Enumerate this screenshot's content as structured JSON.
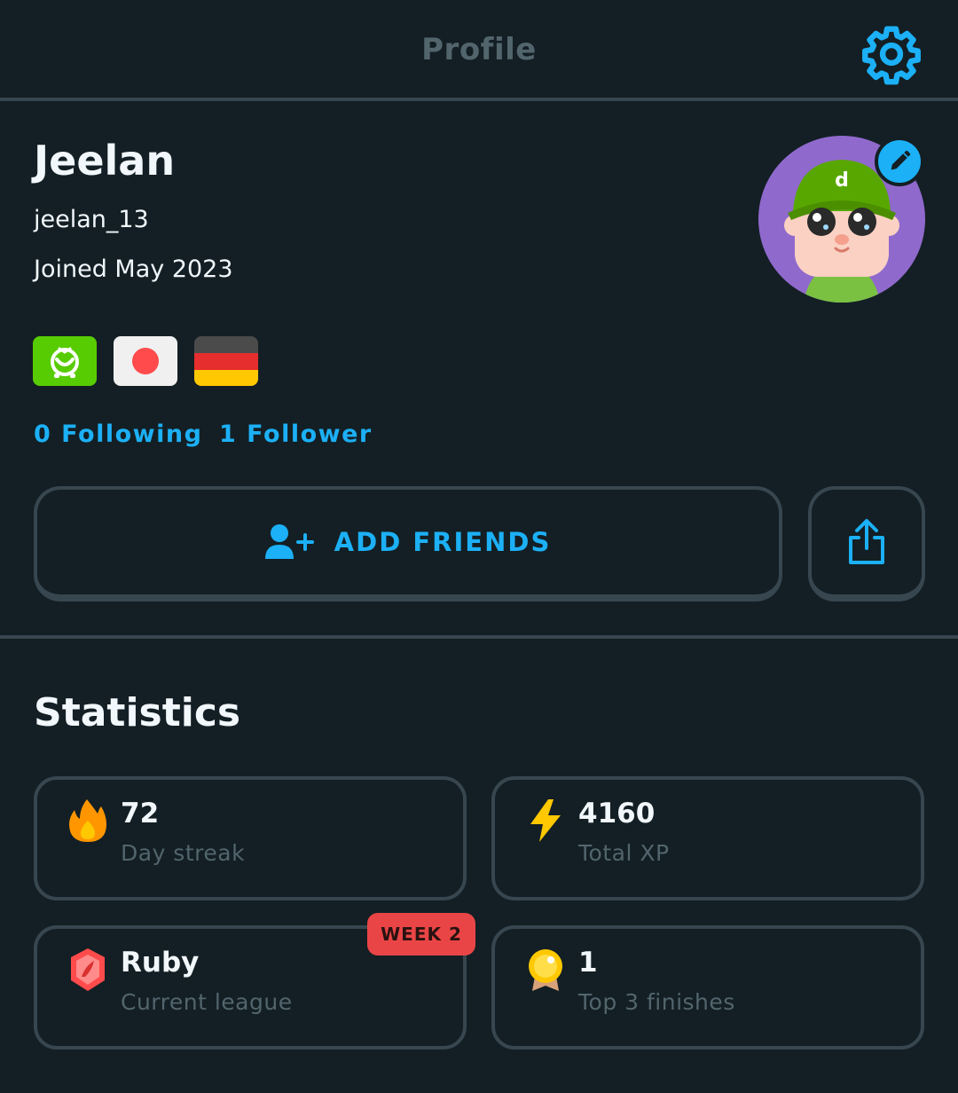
{
  "header": {
    "title": "Profile"
  },
  "profile": {
    "name": "Jeelan",
    "username": "jeelan_13",
    "joined": "Joined May 2023",
    "courses": [
      "duolingo-math-flag",
      "japan-flag",
      "germany-flag"
    ],
    "following": "0 Following",
    "followers": "1 Follower"
  },
  "actions": {
    "add_friends": "ADD FRIENDS",
    "share_icon": "share-icon"
  },
  "statistics": {
    "title": "Statistics",
    "cards": [
      {
        "value": "72",
        "label": "Day streak",
        "icon": "fire-icon"
      },
      {
        "value": "4160",
        "label": "Total XP",
        "icon": "lightning-icon"
      },
      {
        "value": "Ruby",
        "label": "Current league",
        "icon": "ruby-league-icon",
        "badge": "WEEK 2"
      },
      {
        "value": "1",
        "label": "Top 3 finishes",
        "icon": "medal-icon"
      }
    ]
  },
  "colors": {
    "background": "#131f24",
    "accent": "#1cb0f6",
    "border": "#37464f",
    "muted": "#52656d",
    "badge": "#ea4546"
  }
}
